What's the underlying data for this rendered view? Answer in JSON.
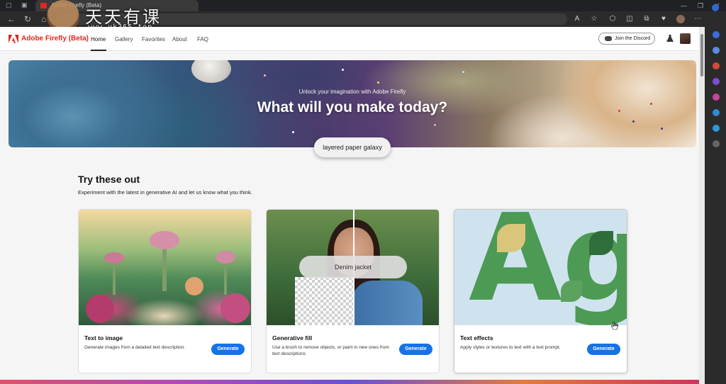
{
  "browser": {
    "tab_title": "Adobe Firefly (Beta)",
    "tab_icon": "adobe-icon",
    "watermark": {
      "title": "天天有课",
      "url": "www.yk365.top"
    }
  },
  "app": {
    "brand": "Adobe Firefly (Beta)",
    "nav": [
      "Home",
      "Gallery",
      "Favorites",
      "About",
      "FAQ"
    ],
    "active_nav": "Home",
    "discord_label": "Join the Discord"
  },
  "hero": {
    "subtitle": "Unlock your imagination with Adobe Firefly",
    "title": "What will you make today?",
    "prompt": "layered paper galaxy"
  },
  "section": {
    "title": "Try these out",
    "subtitle": "Experiment with the latest in generative AI and let us know what you think."
  },
  "cards": [
    {
      "title": "Text to image",
      "description": "Generate images from a detailed text description.",
      "button": "Generate"
    },
    {
      "title": "Generative fill",
      "description": "Use a brush to remove objects, or paint in new ones from text descriptions",
      "button": "Generate",
      "overlay_text": "Denim jacket"
    },
    {
      "title": "Text effects",
      "description": "Apply styles or textures to text with a text prompt.",
      "button": "Generate",
      "overlay_text": "Ag"
    }
  ],
  "colors": {
    "brand": "#e3261d",
    "button": "#1473e6"
  }
}
